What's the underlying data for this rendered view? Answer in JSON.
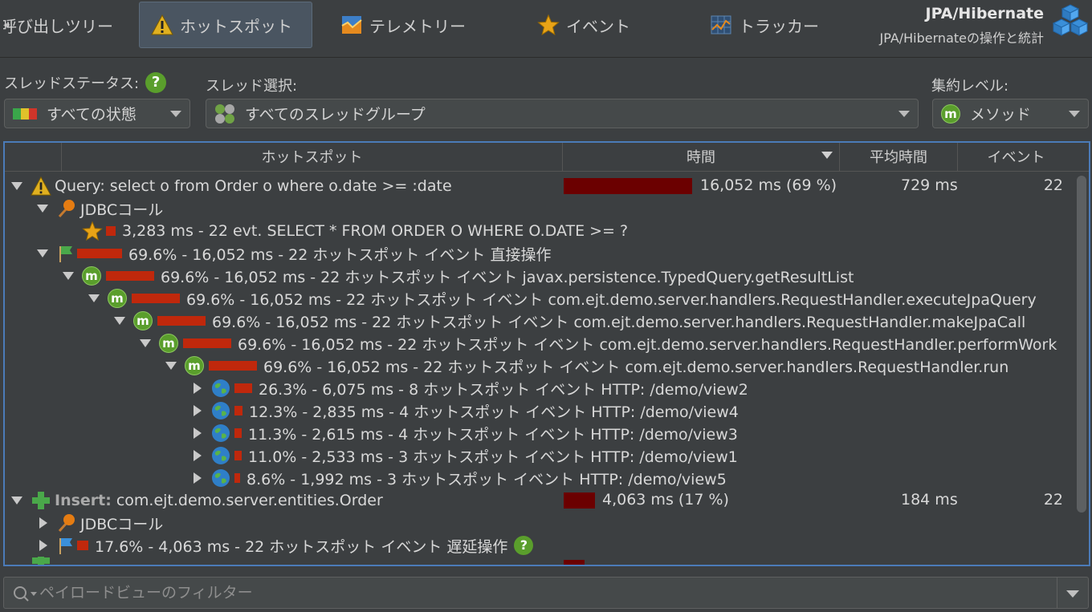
{
  "toolbar": {
    "tabs": [
      {
        "label": "呼び出しツリー",
        "icon": "call-tree-icon"
      },
      {
        "label": "ホットスポット",
        "icon": "warning-icon"
      },
      {
        "label": "テレメトリー",
        "icon": "telemetry-icon"
      },
      {
        "label": "イベント",
        "icon": "star-icon"
      },
      {
        "label": "トラッカー",
        "icon": "tracker-icon"
      }
    ],
    "title": "JPA/Hibernate",
    "subtitle": "JPA/Hibernateの操作と統計"
  },
  "filters": {
    "thread_status_label": "スレッドステータス:",
    "thread_status_value": "すべての状態",
    "thread_select_label": "スレッド選択:",
    "thread_select_value": "すべてのスレッドグループ",
    "aggregation_label": "集約レベル:",
    "aggregation_value": "メソッド"
  },
  "table": {
    "columns": [
      "ホットスポット",
      "時間",
      "平均時間",
      "イベント"
    ],
    "rows": [
      {
        "text": "Query: select o from Order o where o.date >= :date",
        "time": "16,052 ms (69 %)",
        "avg": "729 ms",
        "events": "22",
        "bar_fraction": 0.69
      },
      {
        "text": "JDBCコール"
      },
      {
        "text": "3,283 ms - 22 evt. SELECT * FROM ORDER O WHERE O.DATE >= ?"
      },
      {
        "text": "69.6% - 16,052 ms - 22 ホットスポット イベント 直接操作"
      },
      {
        "text": "69.6% - 16,052 ms - 22 ホットスポット イベント javax.persistence.TypedQuery.getResultList"
      },
      {
        "text": "69.6% - 16,052 ms - 22 ホットスポット イベント com.ejt.demo.server.handlers.RequestHandler.executeJpaQuery"
      },
      {
        "text": "69.6% - 16,052 ms - 22 ホットスポット イベント com.ejt.demo.server.handlers.RequestHandler.makeJpaCall"
      },
      {
        "text": "69.6% - 16,052 ms - 22 ホットスポット イベント com.ejt.demo.server.handlers.RequestHandler.performWork"
      },
      {
        "text": "69.6% - 16,052 ms - 22 ホットスポット イベント com.ejt.demo.server.handlers.RequestHandler.run"
      },
      {
        "text": "26.3% - 6,075 ms - 8 ホットスポット イベント HTTP: /demo/view2"
      },
      {
        "text": "12.3% - 2,835 ms - 4 ホットスポット イベント HTTP: /demo/view4"
      },
      {
        "text": "11.3% - 2,615 ms - 4 ホットスポット イベント HTTP: /demo/view3"
      },
      {
        "text": "11.0% - 2,533 ms - 3 ホットスポット イベント HTTP: /demo/view1"
      },
      {
        "text": "8.6% - 1,992 ms - 3 ホットスポット イベント HTTP: /demo/view5"
      },
      {
        "prefix": "Insert:",
        "text": "com.ejt.demo.server.entities.Order",
        "time": "4,063 ms (17 %)",
        "avg": "184 ms",
        "events": "22",
        "bar_fraction": 0.17
      },
      {
        "text": "JDBCコール"
      },
      {
        "text": "17.6% - 4,063 ms - 22 ホットスポット イベント 遅延操作"
      }
    ]
  },
  "filter": {
    "placeholder": "ペイロードビューのフィルター"
  },
  "colors": {
    "background": "#3c3f41",
    "time_bar": "#6b0000",
    "percent_bar": "#c0280c",
    "selection_border": "#4b7bb8"
  }
}
